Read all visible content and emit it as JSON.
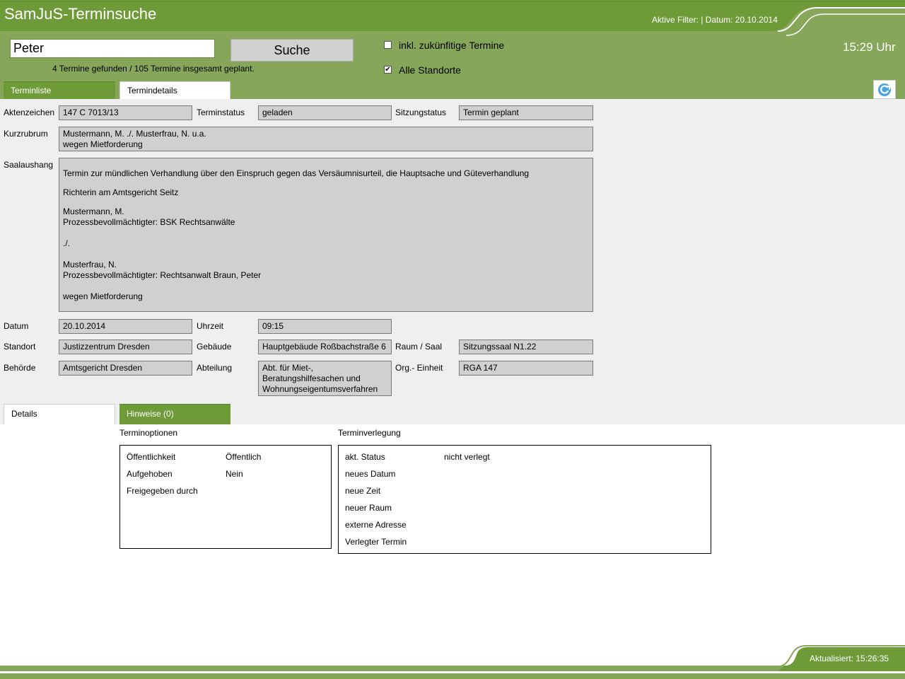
{
  "header": {
    "title": "SamJuS-Terminsuche",
    "filter": "Aktive Filter: | Datum: 20.10.2014",
    "clock": "15:29 Uhr"
  },
  "search": {
    "value": "Peter",
    "button": "Suche",
    "result": "4 Termine gefunden /   105 Termine insgesamt geplant.",
    "future_label": "inkl. zukünfitige Termine",
    "future_checked": false,
    "sites_label": "Alle Standorte",
    "sites_checked": true
  },
  "tabs": {
    "list": "Terminliste",
    "details": "Termindetails"
  },
  "fields": {
    "aktenzeichen_label": "Aktenzeichen",
    "aktenzeichen": "147 C 7013/13",
    "terminstatus_label": "Terminstatus",
    "terminstatus": "geladen",
    "sitzungsstatus_label": "Sitzungstatus",
    "sitzungsstatus": "Termin geplant",
    "kurzrubrum_label": "Kurzrubrum",
    "kurzrubrum_line1": "Mustermann, M. ./. Musterfrau, N. u.a.",
    "kurzrubrum_line2": "wegen Mietforderung",
    "saalaushang_label": "Saalaushang",
    "saalaushang": [
      "Termin zur mündlichen Verhandlung über den Einspruch gegen das Versäumnisurteil, die Hauptsache und Güteverhandlung",
      "Richterin am Amtsgericht Seitz",
      "Mustermann, M.",
      "Prozessbevollmächtigter: BSK Rechtsanwälte",
      "./.",
      "Musterfrau, N.",
      "Prozessbevollmächtigter: Rechtsanwalt Braun, Peter",
      "wegen Mietforderung"
    ],
    "datum_label": "Datum",
    "datum": "20.10.2014",
    "uhrzeit_label": "Uhrzeit",
    "uhrzeit": "09:15",
    "standort_label": "Standort",
    "standort": "Justizzentrum Dresden",
    "gebaeude_label": "Gebäude",
    "gebaeude": "Hauptgebäude Roßbachstraße 6",
    "raum_label": "Raum / Saal",
    "raum": "Sitzungssaal N1.22",
    "behoerde_label": "Behörde",
    "behoerde": "Amtsgericht Dresden",
    "abteilung_label": "Abteilung",
    "abteilung_line1": "Abt. für Miet-,",
    "abteilung_line2": "Beratungshilfesachen und",
    "abteilung_line3": "Wohnungseigentumsverfahren",
    "org_label": "Org.- Einheit",
    "org": "RGA 147"
  },
  "lower_tabs": {
    "details": "Details",
    "hints": "Hinweise (0)"
  },
  "terminoptionen": {
    "title": "Terminoptionen",
    "rows": [
      {
        "label": "Öffentlichkeit",
        "value": "Öffentlich"
      },
      {
        "label": "Aufgehoben",
        "value": "Nein"
      },
      {
        "label": "Freigegeben durch",
        "value": ""
      }
    ]
  },
  "terminverlegung": {
    "title": "Terminverlegung",
    "rows": [
      {
        "label": "akt. Status",
        "value": "nicht verlegt"
      },
      {
        "label": "neues Datum",
        "value": ""
      },
      {
        "label": "neue Zeit",
        "value": ""
      },
      {
        "label": "neuer Raum",
        "value": ""
      },
      {
        "label": "externe Adresse",
        "value": ""
      },
      {
        "label": "Verlegter Termin",
        "value": ""
      }
    ]
  },
  "footer": {
    "updated": "Aktualisiert: 15:26:35"
  },
  "colors": {
    "header_green": "#6e9a38",
    "light_green": "#86a65a",
    "panel_grey": "#efefef",
    "field_grey": "#d0d0d0"
  }
}
